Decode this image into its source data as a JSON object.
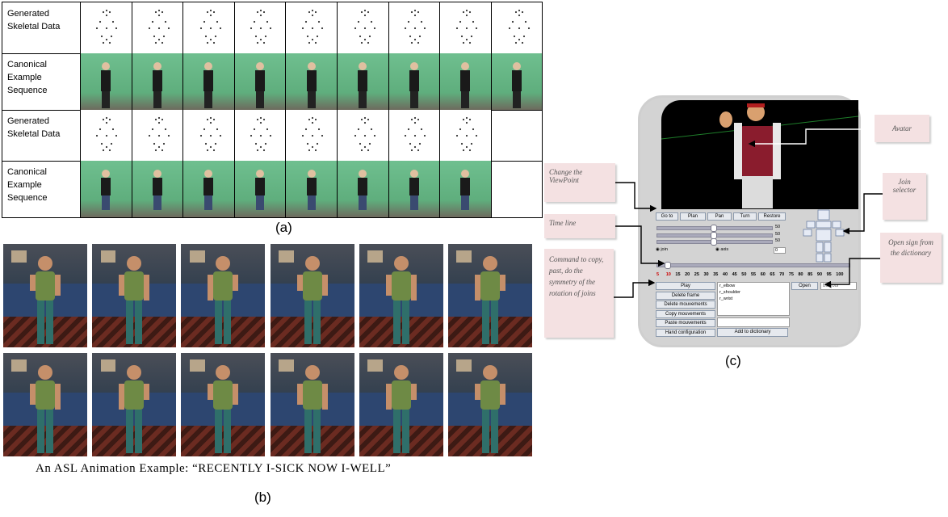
{
  "panel_a": {
    "rows": [
      {
        "label_lines": [
          "Generated",
          "Skeletal Data"
        ],
        "kind": "skeleton",
        "frames": 9
      },
      {
        "label_lines": [
          "Canonical",
          "Example",
          "Sequence"
        ],
        "kind": "video-standing",
        "frames": 9
      },
      {
        "label_lines": [
          "Generated",
          "Skeletal Data"
        ],
        "kind": "skeleton",
        "frames": 8
      },
      {
        "label_lines": [
          "Canonical",
          "Example",
          "Sequence"
        ],
        "kind": "video-seated",
        "frames": 8
      }
    ],
    "caption": "(a)"
  },
  "panel_b": {
    "frame_rows": 2,
    "frames_per_row": 6,
    "caption_text": "An ASL Animation Example: “RECENTLY I-SICK NOW I-WELL”",
    "caption": "(b)"
  },
  "panel_c": {
    "caption": "(c)",
    "toolbar_buttons": [
      "Go to",
      "Plan",
      "Pan",
      "Turn",
      "Restore"
    ],
    "slider_values": [
      "50",
      "50",
      "50"
    ],
    "radio_join": "join",
    "radio_axis": "axis",
    "axis_value": "0",
    "timeline_ticks": [
      "5",
      "10",
      "15",
      "20",
      "25",
      "30",
      "35",
      "40",
      "45",
      "50",
      "55",
      "60",
      "65",
      "70",
      "75",
      "80",
      "85",
      "90",
      "95",
      "100"
    ],
    "command_buttons": [
      "Play",
      "Delete frame",
      "Delete mouvements",
      "Copy mouvements",
      "Paste mouvements",
      "Hand configuration"
    ],
    "joint_list": [
      "r_elbow",
      "r_shoulder",
      "r_wrist"
    ],
    "open_button": "Open",
    "dictionary_value": "bonjour",
    "add_button": "Add to dictionary",
    "notes": {
      "avatar": "Avatar",
      "viewpoint": "Change the ViewPoint",
      "timeline": "Time line",
      "command": "Command to copy, past, do the symmetry of the rotation of joins",
      "join_selector": "Join selector",
      "open_sign": "Open sign from the dictionary"
    },
    "colors": {
      "note_bg": "#f4e1e2",
      "tick_red": "#cc0000"
    }
  }
}
